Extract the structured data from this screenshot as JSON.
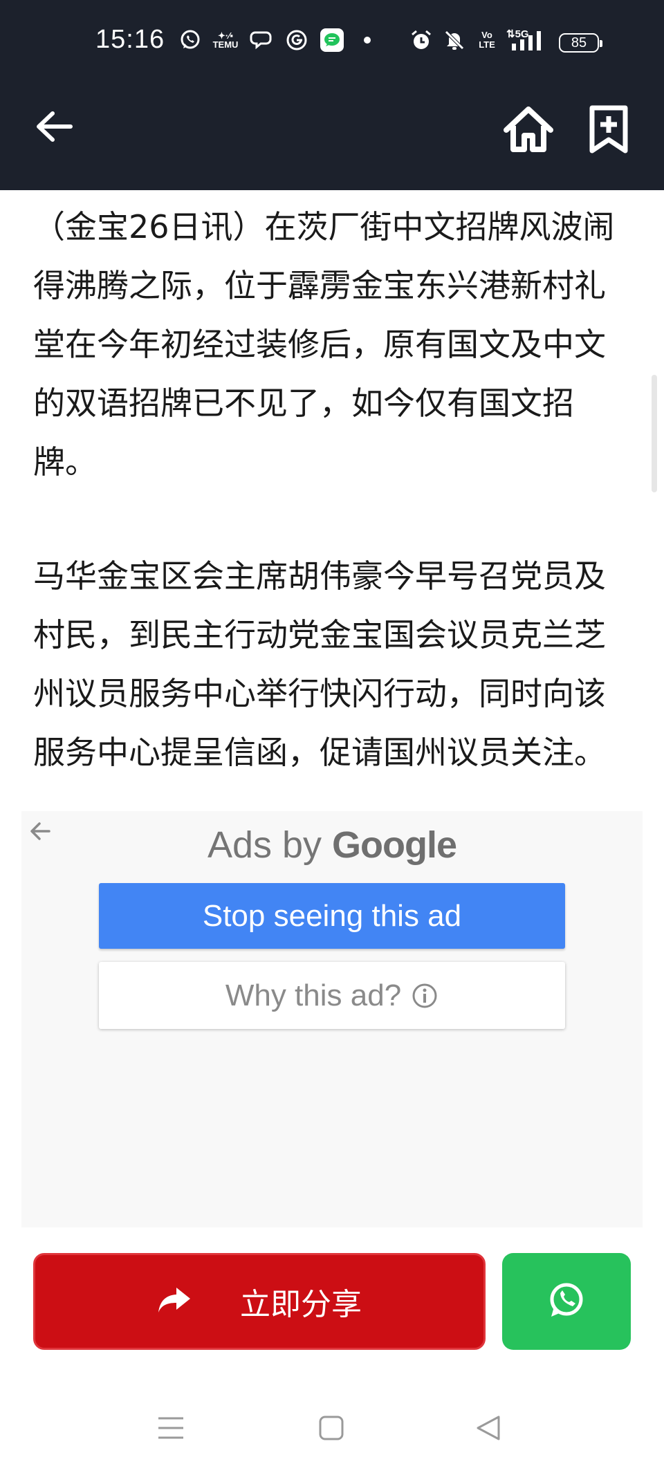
{
  "status_bar": {
    "time": "15:16",
    "icons": [
      "whatsapp-icon",
      "temu-icon",
      "chat-bubble-icon",
      "grammarly-icon",
      "messages-app-icon",
      "dot-icon",
      "alarm-icon",
      "bell-muted-icon",
      "volte-icon",
      "5g-signal-icon"
    ],
    "battery": "85"
  },
  "app_bar": {
    "back_icon": "arrow-left-icon",
    "home_icon": "home-icon",
    "bookmark_icon": "bookmark-add-icon"
  },
  "article": {
    "paragraphs": [
      "（金宝26日讯）在茨厂街中文招牌风波闹得沸腾之际，位于霹雳金宝东兴港新村礼堂在今年初经过装修后，原有国文及中文的双语招牌已不见了，如今仅有国文招牌。",
      "马华金宝区会主席胡伟豪今早号召党员及村民，到民主行动党金宝国会议员克兰芝州议员服务中心举行快闪行动，同时向该服务中心提呈信函，促请国州议员关注。"
    ]
  },
  "ad": {
    "ads_by": "Ads by",
    "brand": "Google",
    "stop_label": "Stop seeing this ad",
    "why_label": "Why this ad?",
    "colors": {
      "stop_bg": "#4285f4",
      "panel_bg": "#f8f8f8"
    }
  },
  "share": {
    "label": "立即分享",
    "colors": {
      "share_bg": "#cc0e14",
      "whatsapp_bg": "#27c25c"
    }
  },
  "nav_bar": {
    "icons": [
      "menu-icon",
      "home-square-icon",
      "back-triangle-icon"
    ]
  }
}
